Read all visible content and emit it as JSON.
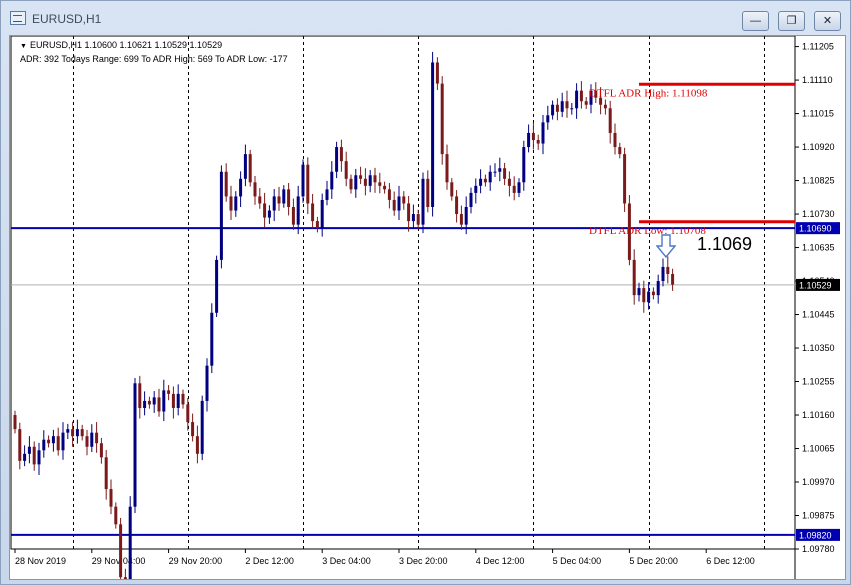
{
  "window": {
    "title": "EURUSD,H1",
    "buttons": {
      "minimize": "—",
      "restore": "❐",
      "close": "✕"
    }
  },
  "header": {
    "ohlc": "EURUSD,H1  1.10600 1.10621 1.10529 1.10529",
    "adr": "ADR: 392   Todays Range: 699   To ADR High: 569   To ADR Low: -177"
  },
  "annotations": {
    "adr_high_label": "DTFL ADR High: 1.11098",
    "adr_low_label": "DTFL ADR Low: 1.10708",
    "big_price": "1.1069"
  },
  "colors": {
    "adr_line": "#e00000",
    "level_line": "#0000b0",
    "bull": "#000080",
    "bear": "#7a1a1a",
    "price_badge": "#0000b0",
    "current_badge": "#000000"
  },
  "chart_data": {
    "type": "candlestick",
    "symbol": "EURUSD",
    "timeframe": "H1",
    "y_ticks": [
      "1.11205",
      "1.11110",
      "1.11015",
      "1.10920",
      "1.10825",
      "1.10730",
      "1.10635",
      "1.10540",
      "1.10445",
      "1.10350",
      "1.10255",
      "1.10160",
      "1.10065",
      "1.09970",
      "1.09875",
      "1.09780"
    ],
    "y_range": [
      1.0978,
      1.11235
    ],
    "x_labels": [
      "28 Nov 2019",
      "29 Nov 04:00",
      "29 Nov 20:00",
      "2 Dec 12:00",
      "3 Dec 04:00",
      "3 Dec 20:00",
      "4 Dec 12:00",
      "5 Dec 04:00",
      "5 Dec 20:00",
      "6 Dec 12:00"
    ],
    "x_label_index": [
      0,
      16,
      32,
      48,
      64,
      80,
      96,
      112,
      128,
      144
    ],
    "separators_index": [
      12,
      36,
      60,
      84,
      108,
      132,
      156
    ],
    "adr_high": 1.11098,
    "adr_low": 1.10708,
    "horizontal_levels": [
      {
        "price": 1.1069,
        "label": "1.10690"
      },
      {
        "price": 1.0982,
        "label": "1.09820"
      }
    ],
    "current_price": {
      "price": 1.10529,
      "label": "1.10529"
    },
    "closes": [
      1.1012,
      1.1003,
      1.1005,
      1.1007,
      1.1002,
      1.1006,
      1.1009,
      1.1008,
      1.101,
      1.1006,
      1.1011,
      1.1012,
      1.101,
      1.1012,
      1.101,
      1.1007,
      1.1011,
      1.1008,
      1.1004,
      1.0995,
      1.099,
      1.0985,
      1.097,
      1.0965,
      1.099,
      1.1025,
      1.1018,
      1.102,
      1.1019,
      1.1021,
      1.1017,
      1.1023,
      1.1022,
      1.1018,
      1.1022,
      1.1019,
      1.1014,
      1.101,
      1.1005,
      1.102,
      1.103,
      1.1045,
      1.106,
      1.1085,
      1.1078,
      1.1074,
      1.1078,
      1.1083,
      1.109,
      1.1082,
      1.1078,
      1.1076,
      1.1072,
      1.1074,
      1.1078,
      1.1076,
      1.108,
      1.1075,
      1.107,
      1.1078,
      1.1087,
      1.1076,
      1.1071,
      1.1069,
      1.1077,
      1.108,
      1.1085,
      1.1092,
      1.1088,
      1.1083,
      1.108,
      1.1084,
      1.1083,
      1.1081,
      1.1084,
      1.1082,
      1.1081,
      1.108,
      1.1077,
      1.1074,
      1.1078,
      1.1076,
      1.1071,
      1.1073,
      1.107,
      1.1083,
      1.1075,
      1.1116,
      1.111,
      1.109,
      1.1082,
      1.1078,
      1.1073,
      1.107,
      1.1075,
      1.1079,
      1.1081,
      1.1083,
      1.1082,
      1.1085,
      1.1085,
      1.1086,
      1.1083,
      1.1081,
      1.1079,
      1.1082,
      1.1092,
      1.1096,
      1.1094,
      1.1093,
      1.1099,
      1.1101,
      1.1104,
      1.1102,
      1.1105,
      1.1103,
      1.1103,
      1.1108,
      1.1105,
      1.1104,
      1.1108,
      1.1106,
      1.1104,
      1.1103,
      1.1096,
      1.1092,
      1.109,
      1.1076,
      1.106,
      1.105,
      1.1052,
      1.1048,
      1.1051,
      1.105,
      1.1054,
      1.1058,
      1.1056,
      1.1053
    ]
  }
}
